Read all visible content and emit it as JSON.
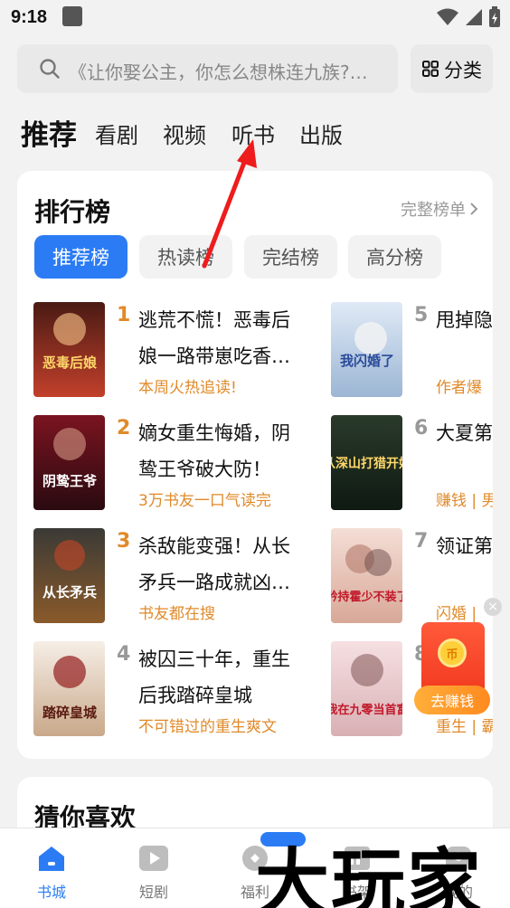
{
  "status": {
    "time": "9:18"
  },
  "search": {
    "placeholder": "《让你娶公主，你怎么想株连九族?…"
  },
  "category_button": {
    "label": "分类"
  },
  "top_tabs": [
    {
      "label": "推荐",
      "active": true
    },
    {
      "label": "看剧"
    },
    {
      "label": "视频"
    },
    {
      "label": "听书"
    },
    {
      "label": "出版"
    }
  ],
  "ranking": {
    "title": "排行榜",
    "more": "完整榜单",
    "tabs": [
      {
        "label": "推荐榜",
        "active": true
      },
      {
        "label": "热读榜"
      },
      {
        "label": "完结榜"
      },
      {
        "label": "高分榜"
      }
    ],
    "items": [
      {
        "rank": "1",
        "title": "逃荒不慌！恶毒后娘一路带崽吃香…",
        "tag": "本周火热追读!",
        "cover_text": "恶毒后娘"
      },
      {
        "rank": "2",
        "title": "嫡女重生悔婚，阴鸷王爷破大防！",
        "tag": "3万书友一口气读完",
        "cover_text": "阴鸷王爷"
      },
      {
        "rank": "3",
        "title": "杀敌能变强！从长矛兵一路成就凶…",
        "tag": "书友都在搜",
        "cover_text": "从长矛兵"
      },
      {
        "rank": "4",
        "title": "被囚三十年，重生后我踏碎皇城",
        "tag": "不可错过的重生爽文",
        "cover_text": "踏碎皇城"
      },
      {
        "rank": "5",
        "title": "甩掉隐婚跟上司",
        "tag": "作者爆",
        "cover_text": "我闪婚了"
      },
      {
        "rank": "6",
        "title": "大夏第山打猎",
        "tag": "赚钱 | 男",
        "cover_text": "从深山打猎开始"
      },
      {
        "rank": "7",
        "title": "领证第生来衬",
        "tag": "闪婚 |",
        "cover_text": "矜持霍少不装了"
      },
      {
        "rank": "8",
        "title": "",
        "tag": "重生 | 霸",
        "cover_text": "我在九零当首富"
      }
    ]
  },
  "guess": {
    "title": "猜你喜欢"
  },
  "float_reward": {
    "label": "去赚钱",
    "coin": "币"
  },
  "bottom_nav": [
    {
      "label": "书城",
      "icon": "home-icon",
      "active": true
    },
    {
      "label": "短剧",
      "icon": "play-icon"
    },
    {
      "label": "福利",
      "icon": "gift-icon"
    },
    {
      "label": "书架",
      "icon": "shelf-icon"
    },
    {
      "label": "我的",
      "icon": "profile-icon"
    }
  ],
  "watermark": "大玩家",
  "colors": {
    "accent": "#2b7cf4",
    "tag": "#e08a2a",
    "background": "#f2f2f2"
  }
}
